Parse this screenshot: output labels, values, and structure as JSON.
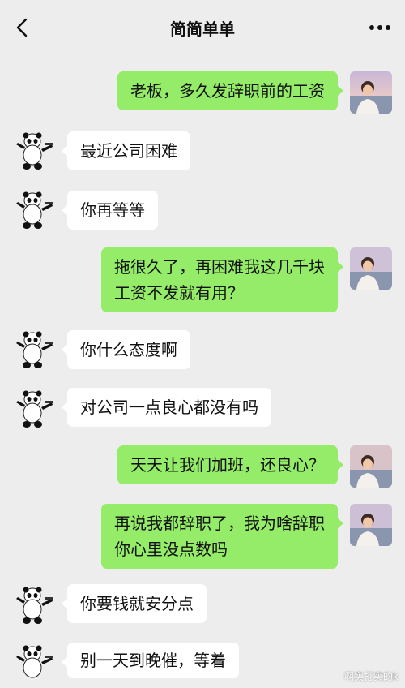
{
  "header": {
    "title": "简简单单"
  },
  "messages": [
    {
      "side": "self",
      "text": "老板，多久发辞职前的工资"
    },
    {
      "side": "other",
      "text": "最近公司困难"
    },
    {
      "side": "other",
      "text": "你再等等"
    },
    {
      "side": "self",
      "text": "拖很久了，再困难我这几千块\n工资不发就有用？"
    },
    {
      "side": "other",
      "text": "你什么态度啊"
    },
    {
      "side": "other",
      "text": "对公司一点良心都没有吗"
    },
    {
      "side": "self",
      "text": "天天让我们加班，还良心？"
    },
    {
      "side": "self",
      "text": "再说我都辞职了，我为啥辞职\n你心里没点数吗"
    },
    {
      "side": "other",
      "text": "你要钱就安分点"
    },
    {
      "side": "other",
      "text": "别一天到晚催，等着"
    }
  ],
  "watermark": "啊实打实的k",
  "icons": {
    "back": "back-arrow-icon",
    "more": "more-dots-icon",
    "self_avatar": "person-photo-avatar",
    "other_avatar": "panda-avatar"
  },
  "colors": {
    "background": "#ededed",
    "self_bubble": "#95ec69",
    "other_bubble": "#ffffff"
  }
}
